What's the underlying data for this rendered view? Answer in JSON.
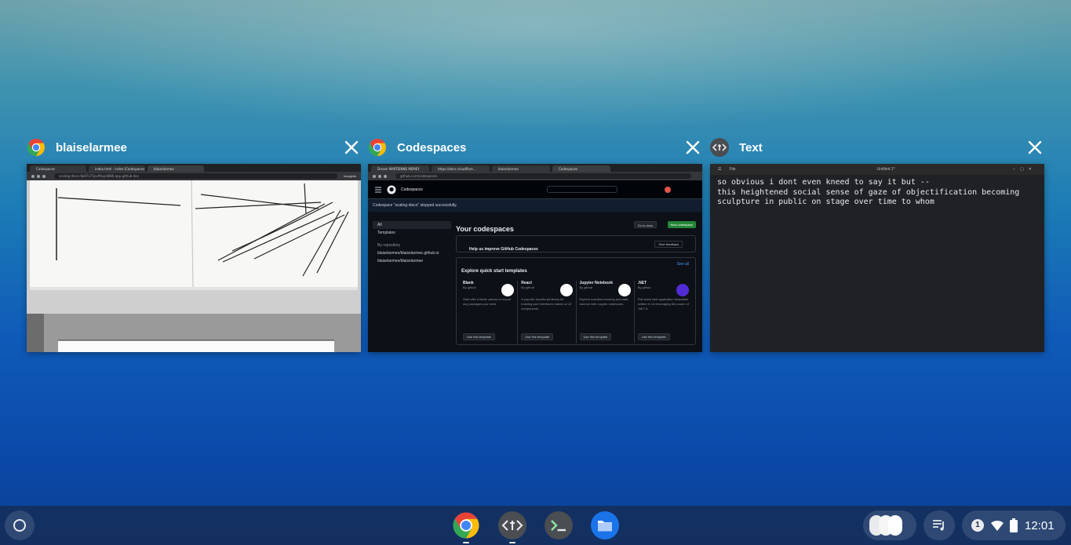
{
  "overview": {
    "windows": [
      {
        "app": "chrome",
        "title": "blaiselarmee",
        "tabs": [
          "Codespaces",
          "index.html - index [Codespaces",
          "blaiselarmee"
        ],
        "url": "scaling-disco-9p67x75pv9fxg-8080.app.github.dev",
        "incognito_label": "Incognito"
      },
      {
        "app": "chrome",
        "title": "Codespaces",
        "tabs": [
          "Dream MARTIENNE MEMEY",
          "https://docs.cloudflare...",
          "blaiselarmee",
          "Codespaces"
        ],
        "url": "github.com/codespaces",
        "toast": "Codespace \"scaling-disco\" stopped successfully.",
        "sidebar": [
          "All",
          "Templates",
          "By repository",
          "blaiselarmee/blaiselarmee.github.io",
          "blaiselarmee/blaiselarmee"
        ],
        "heading": "Your codespaces",
        "btn_go_to_docs": "Go to docs",
        "btn_new": "New codespace",
        "feedback_title": "Help us improve GitHub Codespaces",
        "feedback_btn": "Give feedback",
        "templates_heading": "Explore quick start templates",
        "see_all": "See all",
        "templates": [
          {
            "name": "Blank",
            "by": "By github",
            "desc": "Start with a blank canvas or import any packages you need.",
            "btn": "Use this template"
          },
          {
            "name": "React",
            "by": "By github",
            "desc": "A popular JavaScript library for building user interfaces based on UI components.",
            "btn": "Use this template"
          },
          {
            "name": "Jupyter Notebook",
            "by": "By github",
            "desc": "Explore machine learning and data science with Jupyter notebooks.",
            "btn": "Use this template"
          },
          {
            "name": ".NET",
            "by": "By github",
            "desc": "Full-stack web application templates written in C# leveraging the power of .NET 8.",
            "btn": "Use this template"
          }
        ]
      },
      {
        "app": "text",
        "title": "Text",
        "tab_label": "Untitled 1*",
        "file_label": "File",
        "lines": [
          "so obvious i dont even kneed to say it but --",
          "this heightened social sense of gaze of objectification becoming",
          "sculpture in public on stage over time to whom"
        ]
      }
    ]
  },
  "shelf": {
    "apps": [
      "chrome",
      "text",
      "terminal",
      "files"
    ],
    "notification_count": "1",
    "clock": "12:01"
  },
  "colors": {
    "chrome_red": "#ea4335",
    "chrome_yellow": "#fbbc05",
    "chrome_green": "#34a853",
    "chrome_blue": "#4285f4",
    "github_green": "#238636",
    "files_blue": "#1a73e8"
  }
}
